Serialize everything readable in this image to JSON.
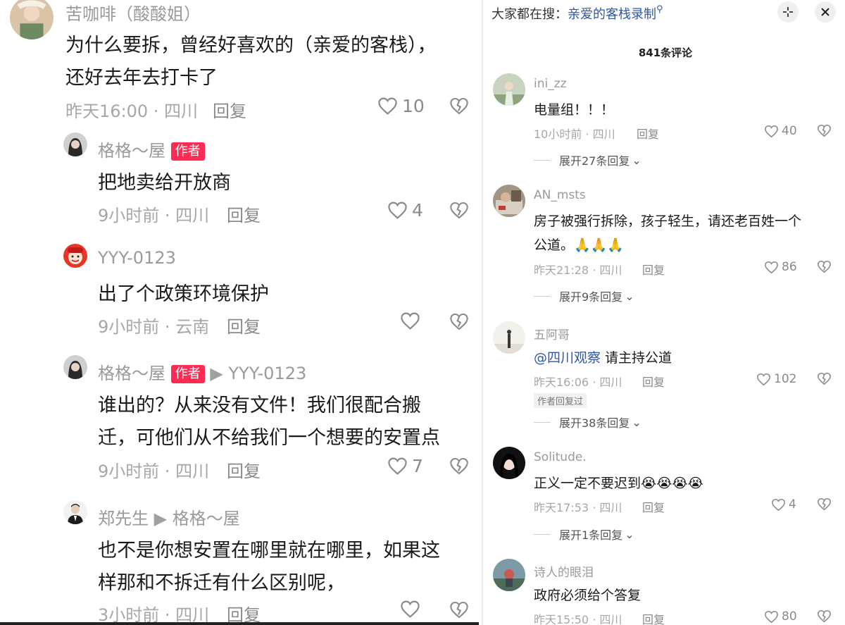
{
  "left": {
    "comments": [
      {
        "name": "苦咖啡（酸酸姐）",
        "lines": [
          "为什么要拆，曾经好喜欢的（亲爱的客栈），",
          "还好去年去打卡了"
        ],
        "time": "昨天16:00 · 四川",
        "reply": "回复",
        "likes": "10"
      },
      {
        "name": "格格～屋",
        "badge": "作者",
        "lines": [
          "把地卖给开放商"
        ],
        "time": "9小时前 · 四川",
        "reply": "回复",
        "likes": "4"
      },
      {
        "name": "YYY-0123",
        "lines": [
          "出了个政策环境保护"
        ],
        "time": "9小时前 · 云南",
        "reply": "回复",
        "likes": ""
      },
      {
        "name": "格格～屋",
        "badge": "作者",
        "reply_to": "YYY-0123",
        "lines": [
          "谁出的？从来没有文件！我们很配合搬",
          "迁，可他们从不给我们一个想要的安置点"
        ],
        "time": "9小时前 · 四川",
        "reply": "回复",
        "likes": "7"
      },
      {
        "name": "郑先生",
        "reply_to": "格格～屋",
        "lines": [
          "也不是你想安置在哪里就在哪里，如果这",
          "样那和不拆迁有什么区别呢，"
        ],
        "time": "3小时前 · 四川",
        "reply": "回复",
        "likes": ""
      }
    ]
  },
  "right": {
    "header": {
      "search_prefix": "大家都在搜：",
      "search_query": "亲爱的客栈录制"
    },
    "count_label": "841条评论",
    "comments": [
      {
        "name": "ini_zz",
        "text": "电量组！！！",
        "time": "10小时前 · 四川",
        "reply": "回复",
        "likes": "40",
        "expand": "展开27条回复"
      },
      {
        "name": "AN_msts",
        "lines": [
          "房子被强行拆除，孩子轻生，请还老百姓一个",
          "公道。🙏🙏🙏"
        ],
        "time": "昨天21:28 · 四川",
        "reply": "回复",
        "likes": "86",
        "expand": "展开9条回复"
      },
      {
        "name": "五阿哥",
        "mention": "@四川观察",
        "text": " 请主持公道",
        "time": "昨天16:06 · 四川",
        "reply": "回复",
        "likes": "102",
        "tag": "作者回复过",
        "expand": "展开38条回复"
      },
      {
        "name": "Solitude.",
        "text": "正义一定不要迟到😭😭😭😭",
        "time": "昨天17:53 · 四川",
        "reply": "回复",
        "likes": "4",
        "expand": "展开1条回复"
      },
      {
        "name": "诗人的眼泪",
        "text": "政府必须给个答复",
        "time": "昨天15:50 · 四川",
        "reply": "回复",
        "likes": "80"
      }
    ]
  },
  "colors": {
    "badge": "#fe2c55",
    "link": "#2f57a3",
    "meta": "#a7a7a7"
  }
}
